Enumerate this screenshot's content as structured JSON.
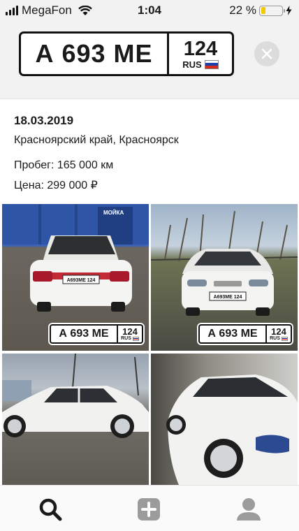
{
  "status_bar": {
    "carrier": "MegaFon",
    "time": "1:04",
    "battery_percent": "22 %",
    "battery_level": 0.22,
    "battery_color": "#f3c900"
  },
  "plate": {
    "number": "А 693 МЕ",
    "region": "124",
    "country": "RUS",
    "flag_colors": [
      "#ffffff",
      "#1c3fa8",
      "#d52b1e"
    ]
  },
  "listing": {
    "date": "18.03.2019",
    "location": "Красноярский край, Красноярск",
    "mileage": "Пробег: 165 000 км",
    "price": "Цена: 299 000 ₽"
  },
  "photos": [
    {
      "icon": "car-rear-photo",
      "sign_text": "МОЙКА",
      "plate_text": "А693МЕ 124"
    },
    {
      "icon": "car-front-photo",
      "plate_text": "А693МЕ 124"
    },
    {
      "icon": "car-side-photo"
    },
    {
      "icon": "car-front-quarter-photo"
    }
  ],
  "tabbar": {
    "items": [
      {
        "icon": "search-icon",
        "active": true
      },
      {
        "icon": "add-icon",
        "active": false
      },
      {
        "icon": "profile-icon",
        "active": false
      }
    ],
    "active_color": "#1a1a1a",
    "inactive_color": "#9b9b9b"
  }
}
